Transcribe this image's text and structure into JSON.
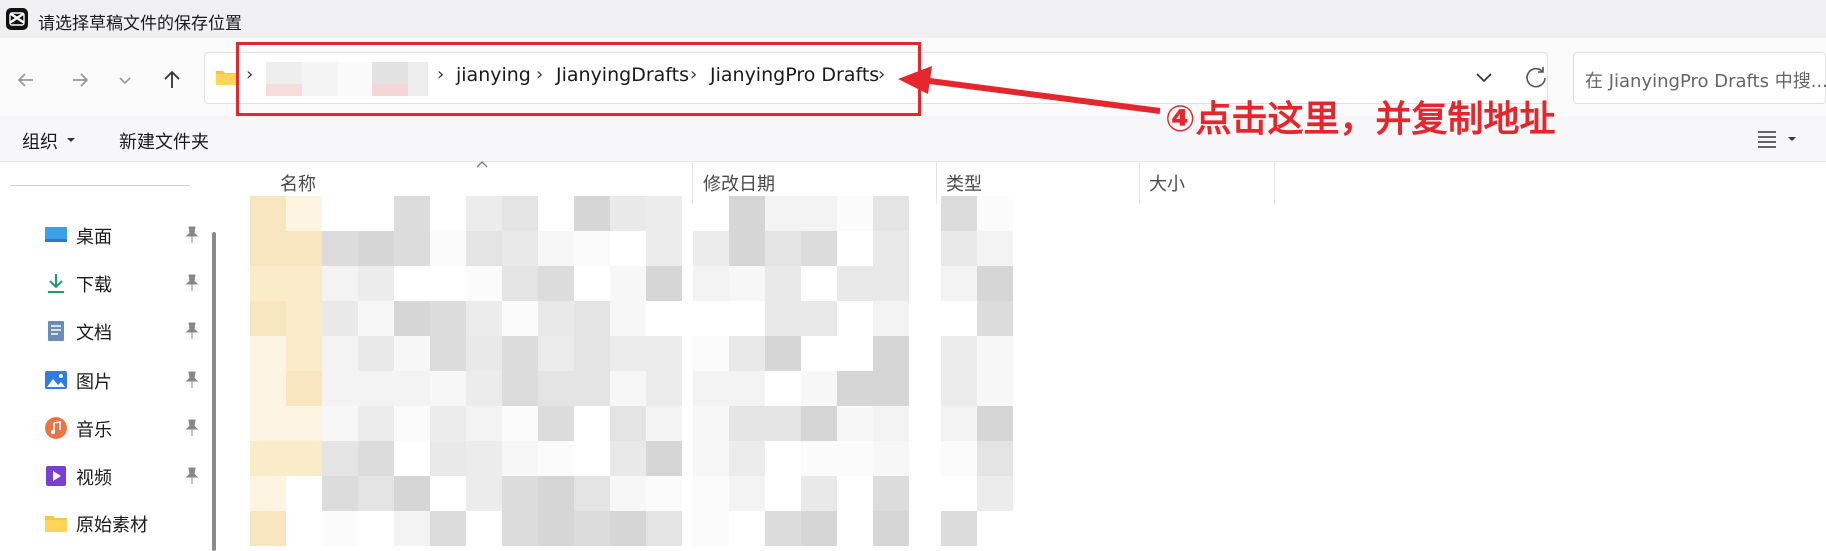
{
  "window": {
    "title": "请选择草稿文件的保存位置"
  },
  "address": {
    "crumbs": [
      "jianying",
      "JianyingDrafts",
      "JianyingPro Drafts"
    ],
    "separator": "›"
  },
  "search": {
    "placeholder": "在 JianyingPro Drafts 中搜..."
  },
  "toolbar": {
    "organize_label": "组织",
    "new_folder_label": "新建文件夹"
  },
  "sidebar": {
    "items": [
      {
        "label": "桌面",
        "icon": "desktop-icon",
        "pinned": true
      },
      {
        "label": "下载",
        "icon": "download-icon",
        "pinned": true
      },
      {
        "label": "文档",
        "icon": "document-icon",
        "pinned": true
      },
      {
        "label": "图片",
        "icon": "pictures-icon",
        "pinned": true
      },
      {
        "label": "音乐",
        "icon": "music-icon",
        "pinned": true
      },
      {
        "label": "视频",
        "icon": "video-icon",
        "pinned": true
      },
      {
        "label": "原始素材",
        "icon": "folder-icon",
        "pinned": false
      }
    ]
  },
  "columns": [
    "名称",
    "修改日期",
    "类型",
    "大小"
  ],
  "annotation": {
    "text": "④点击这里，并复制地址",
    "color": "#e5272d"
  }
}
